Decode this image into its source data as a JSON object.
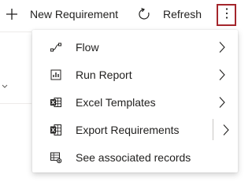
{
  "command_bar": {
    "new_label": "New Requirement",
    "refresh_label": "Refresh",
    "new_icon": "plus-icon",
    "refresh_icon": "refresh-icon",
    "more_icon": "more-vertical-icon",
    "more_border_color": "#a4262c"
  },
  "menu": {
    "items": [
      {
        "label": "Flow",
        "icon": "flow-icon",
        "has_submenu": true
      },
      {
        "label": "Run Report",
        "icon": "report-icon",
        "has_submenu": true
      },
      {
        "label": "Excel Templates",
        "icon": "excel-icon",
        "has_submenu": true
      },
      {
        "label": "Export Requirements",
        "icon": "excel-export-icon",
        "has_submenu": true,
        "split": true
      },
      {
        "label": "See associated records",
        "icon": "associated-records-icon",
        "has_submenu": false
      }
    ]
  },
  "colors": {
    "text": "#201f1e",
    "divider": "#c8c6c4"
  }
}
